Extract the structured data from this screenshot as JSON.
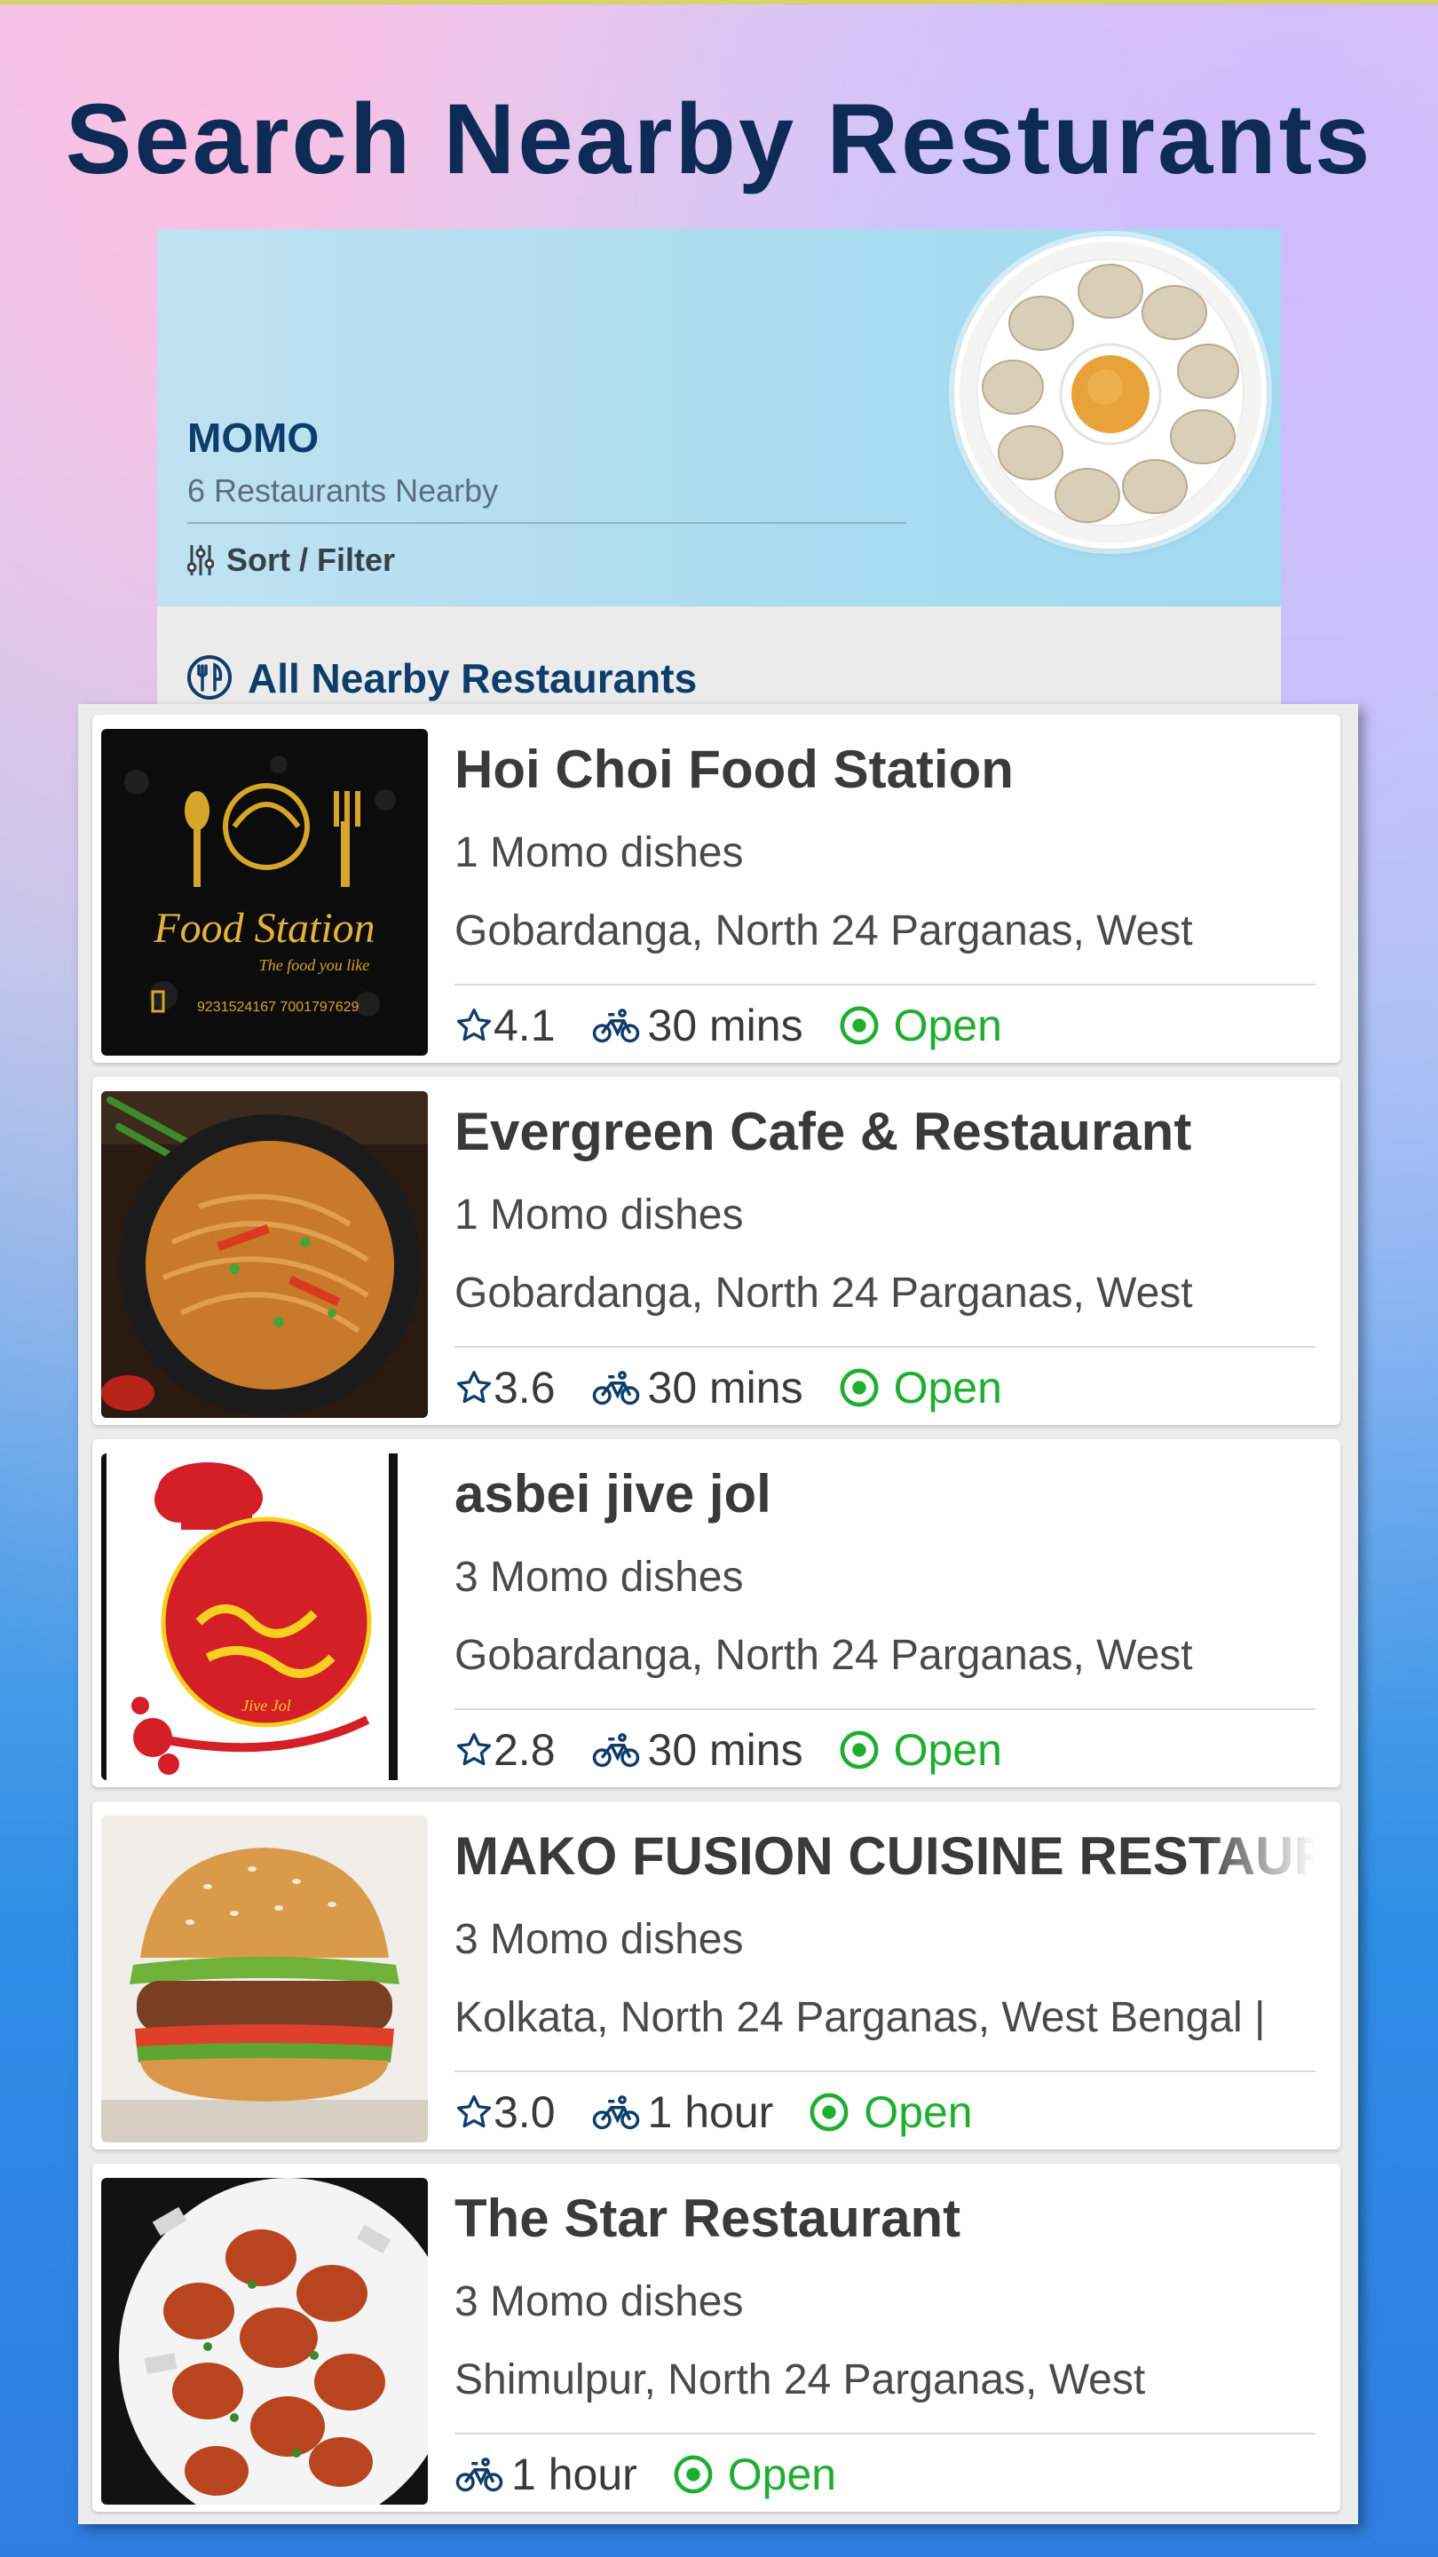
{
  "page": {
    "title": "Search Nearby Resturants"
  },
  "hero": {
    "title": "MOMO",
    "subtitle": "6 Restaurants Nearby",
    "sort_filter_label": "Sort / Filter"
  },
  "section": {
    "title": "All Nearby Restaurants"
  },
  "restaurants": [
    {
      "name": "Hoi Choi Food Station",
      "dishes": "1 Momo dishes",
      "address": "Gobardanga, North 24 Parganas, West",
      "rating": "4.1",
      "delivery": "30 mins",
      "status": "Open"
    },
    {
      "name": "Evergreen Cafe & Restaurant",
      "dishes": "1 Momo dishes",
      "address": "Gobardanga, North 24 Parganas, West",
      "rating": "3.6",
      "delivery": "30 mins",
      "status": "Open"
    },
    {
      "name": "asbei jive jol",
      "dishes": "3 Momo dishes",
      "address": "Gobardanga, North 24 Parganas, West",
      "rating": "2.8",
      "delivery": "30 mins",
      "status": "Open"
    },
    {
      "name": "MAKO FUSION CUISINE RESTAURANT",
      "dishes": "3 Momo dishes",
      "address": "Kolkata, North 24 Parganas, West Bengal |",
      "rating": "3.0",
      "delivery": "1 hour",
      "status": "Open"
    },
    {
      "name": "The Star Restaurant",
      "dishes": "3 Momo dishes",
      "address": "Shimulpur, North 24 Parganas, West",
      "delivery": "1 hour",
      "status": "Open"
    }
  ],
  "logo": {
    "food_station_text": "Food Station",
    "food_station_tagline": "The food you like",
    "food_station_phone": "9231524167   7001797629",
    "jive_jol_text": "Jive Jol"
  },
  "colors": {
    "title": "#0d2b55",
    "accent": "#0e3d6b",
    "open": "#1fae2f",
    "icon": "#0e3d6b"
  }
}
